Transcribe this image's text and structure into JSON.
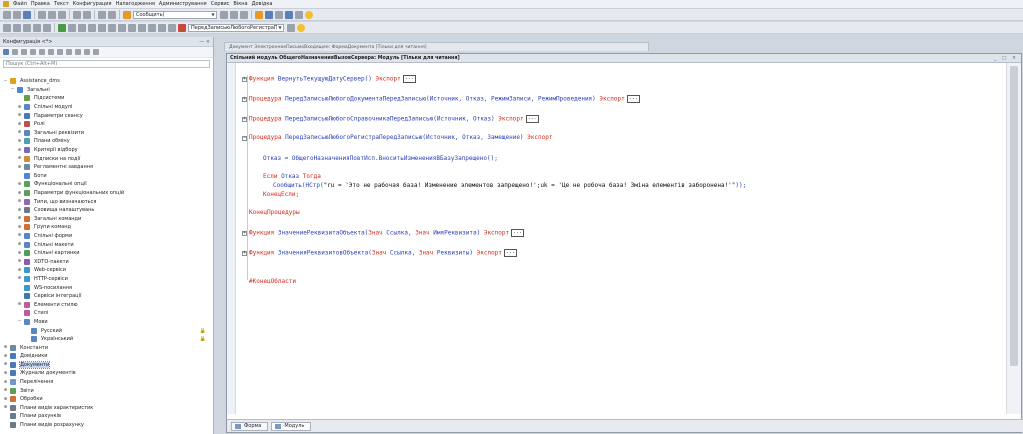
{
  "menubar": {
    "items": [
      "Файл",
      "Правка",
      "Текст",
      "Конфигурация",
      "Налагодження",
      "Администрування",
      "Сервис",
      "Вікна",
      "Довідка"
    ]
  },
  "toolbar1": {
    "search_value": "Сообщить("
  },
  "toolbar2": {
    "combo_value": "ПередЗаписьюЛюбогоРегистраПеред3"
  },
  "left_panel": {
    "title": "Конфигурація  <*>",
    "controls": "— ×",
    "search_placeholder": "Пошук (Ctrl+Alt+M)",
    "tree": [
      {
        "label": "Assistance_dms",
        "indent": 0,
        "exp": "−",
        "icon": "#e0a020",
        "lock": ""
      },
      {
        "label": "Загальні",
        "indent": 1,
        "exp": "−",
        "icon": "#4a8ad0",
        "lock": ""
      },
      {
        "label": "Підсистеми",
        "indent": 2,
        "exp": "",
        "icon": "#6b9a4a",
        "lock": ""
      },
      {
        "label": "Спільні модулі",
        "indent": 2,
        "exp": "⊕",
        "icon": "#5a86c5",
        "lock": ""
      },
      {
        "label": "Параметри сеансу",
        "indent": 2,
        "exp": "⊕",
        "icon": "#4a7ab5",
        "lock": ""
      },
      {
        "label": "Ролі",
        "indent": 2,
        "exp": "⊕",
        "icon": "#c0504d",
        "lock": ""
      },
      {
        "label": "Загальні реквізити",
        "indent": 2,
        "exp": "⊕",
        "icon": "#5a86c5",
        "lock": ""
      },
      {
        "label": "Плани обміну",
        "indent": 2,
        "exp": "⊕",
        "icon": "#4aa0b5",
        "lock": ""
      },
      {
        "label": "Критерії відбору",
        "indent": 2,
        "exp": "⊕",
        "icon": "#7a6ab5",
        "lock": ""
      },
      {
        "label": "Підписки на події",
        "indent": 2,
        "exp": "⊕",
        "icon": "#d09030",
        "lock": ""
      },
      {
        "label": "Регламентні завдання",
        "indent": 2,
        "exp": "⊕",
        "icon": "#6a8aa5",
        "lock": ""
      },
      {
        "label": "Боти",
        "indent": 2,
        "exp": "",
        "icon": "#4a8ad0",
        "lock": ""
      },
      {
        "label": "Функціональні опції",
        "indent": 2,
        "exp": "⊕",
        "icon": "#5aa05a",
        "lock": ""
      },
      {
        "label": "Параметри функціональних опцій",
        "indent": 2,
        "exp": "⊕",
        "icon": "#5aa05a",
        "lock": ""
      },
      {
        "label": "Типи, що визначаються",
        "indent": 2,
        "exp": "⊕",
        "icon": "#8a6ab5",
        "lock": ""
      },
      {
        "label": "Сховища налаштувань",
        "indent": 2,
        "exp": "⊕",
        "icon": "#6a7a8a",
        "lock": ""
      },
      {
        "label": "Загальні команди",
        "indent": 2,
        "exp": "⊕",
        "icon": "#d07030",
        "lock": ""
      },
      {
        "label": "Групи команд",
        "indent": 2,
        "exp": "⊕",
        "icon": "#d07030",
        "lock": ""
      },
      {
        "label": "Спільні форми",
        "indent": 2,
        "exp": "⊕",
        "icon": "#5a86c5",
        "lock": ""
      },
      {
        "label": "Спільні макети",
        "indent": 2,
        "exp": "⊕",
        "icon": "#5a86c5",
        "lock": ""
      },
      {
        "label": "Спільні картинки",
        "indent": 2,
        "exp": "⊕",
        "icon": "#4aa05a",
        "lock": ""
      },
      {
        "label": "XDTO-пакети",
        "indent": 2,
        "exp": "⊕",
        "icon": "#8a5ab5",
        "lock": ""
      },
      {
        "label": "Web-сервіси",
        "indent": 2,
        "exp": "⊕",
        "icon": "#3a9ad0",
        "lock": ""
      },
      {
        "label": "HTTP-сервіси",
        "indent": 2,
        "exp": "⊕",
        "icon": "#3a9ad0",
        "lock": ""
      },
      {
        "label": "WS-посилання",
        "indent": 2,
        "exp": "",
        "icon": "#3a9ad0",
        "lock": ""
      },
      {
        "label": "Сервіси інтеграції",
        "indent": 2,
        "exp": "",
        "icon": "#3a7ab0",
        "lock": ""
      },
      {
        "label": "Елементи стилю",
        "indent": 2,
        "exp": "⊕",
        "icon": "#c05a9a",
        "lock": ""
      },
      {
        "label": "Стилі",
        "indent": 2,
        "exp": "",
        "icon": "#c05a9a",
        "lock": ""
      },
      {
        "label": "Мови",
        "indent": 2,
        "exp": "−",
        "icon": "#5a86c5",
        "lock": ""
      },
      {
        "label": "Русский",
        "indent": 3,
        "exp": "",
        "icon": "#5a86c5",
        "lock": "🔒"
      },
      {
        "label": "Український",
        "indent": 3,
        "exp": "",
        "icon": "#5a86c5",
        "lock": "🔒"
      },
      {
        "label": "Константи",
        "indent": 0,
        "exp": "⊕",
        "icon": "#6a8aa5",
        "lock": ""
      },
      {
        "label": "Довідники",
        "indent": 0,
        "exp": "⊕",
        "icon": "#4a7ab5",
        "lock": ""
      },
      {
        "label": "Документи",
        "indent": 0,
        "exp": "⊕",
        "icon": "#4a7ab5",
        "lock": "",
        "selected": true
      },
      {
        "label": "Журнали документів",
        "indent": 0,
        "exp": "⊕",
        "icon": "#4a7ab5",
        "lock": ""
      },
      {
        "label": "Перелічення",
        "indent": 0,
        "exp": "⊕",
        "icon": "#6a9ad0",
        "lock": ""
      },
      {
        "label": "Звіти",
        "indent": 0,
        "exp": "⊕",
        "icon": "#5aa05a",
        "lock": ""
      },
      {
        "label": "Обробки",
        "indent": 0,
        "exp": "⊕",
        "icon": "#d07030",
        "lock": ""
      },
      {
        "label": "Плани видів характеристик",
        "indent": 0,
        "exp": "⊕",
        "icon": "#6a7a8a",
        "lock": ""
      },
      {
        "label": "Плани рахунків",
        "indent": 0,
        "exp": "",
        "icon": "#6a7a8a",
        "lock": ""
      },
      {
        "label": "Плани видів розрахунку",
        "indent": 0,
        "exp": "",
        "icon": "#6a7a8a",
        "lock": ""
      }
    ]
  },
  "editor": {
    "back_tab": "Документ ЭлектронноеПисьмоВходящее: ФормаДокумента [Тільки для читання]",
    "title": "Спільний модуль ОбщегоНазначенияВызовСервера: Модуль [Тільки для читання]",
    "window_controls": "_ □ ×",
    "bottom_tabs": [
      "Форма",
      "Модуль"
    ],
    "ellipsis": "...",
    "lines": [
      {
        "text": "Функция ВернутьТекущуюДатуСервер() Экспорт",
        "kind": "fn",
        "ell": true
      },
      {
        "text": "Процедура ПередЗаписьюЛюбогоДокументаПередЗаписью(Источник, Отказ, РежимЗаписи, РежимПроведения) Экспорт",
        "kind": "fn",
        "ell": true
      },
      {
        "text": "Процедура ПередЗаписьюЛюбогоСправочникаПередЗаписью(Источник, Отказ) Экспорт",
        "kind": "fn",
        "ell": true
      },
      {
        "text": "Процедура ПередЗаписьюЛюбогоРегистраПередЗаписью(Источник, Отказ, Замещение) Экспорт",
        "kind": "fn",
        "ell": false
      },
      {
        "text": "Отказ = ОбщегоНазначенияПовтИсп.ВноситьИзмененияВБазуЗапрещено();",
        "kind": "stmt",
        "ell": false
      },
      {
        "text": "Если Отказ Тогда",
        "kind": "if",
        "ell": false
      },
      {
        "text": "Сообщить(НСтр(\"ru = 'Это не рабочая база! Изменение элементов запрещено!';uk = 'Це не робоча база! Зміна елементів заборонена!'\"));",
        "kind": "msg",
        "ell": false
      },
      {
        "text": "КонецЕсли;",
        "kind": "endif",
        "ell": false
      },
      {
        "text": "КонецПроцедуры",
        "kind": "end",
        "ell": false
      },
      {
        "text": "Функция ЗначениеРеквизитаОбъекта(Знач Ссылка, Знач ИмяРеквизита) Экспорт",
        "kind": "fn",
        "ell": true
      },
      {
        "text": "Функция ЗначенияРеквизитовОбъекта(Знач Ссылка, Знач Реквизиты) Экспорт",
        "kind": "fn",
        "ell": true
      },
      {
        "text": "#КонецОбласти",
        "kind": "region",
        "ell": false
      }
    ]
  }
}
